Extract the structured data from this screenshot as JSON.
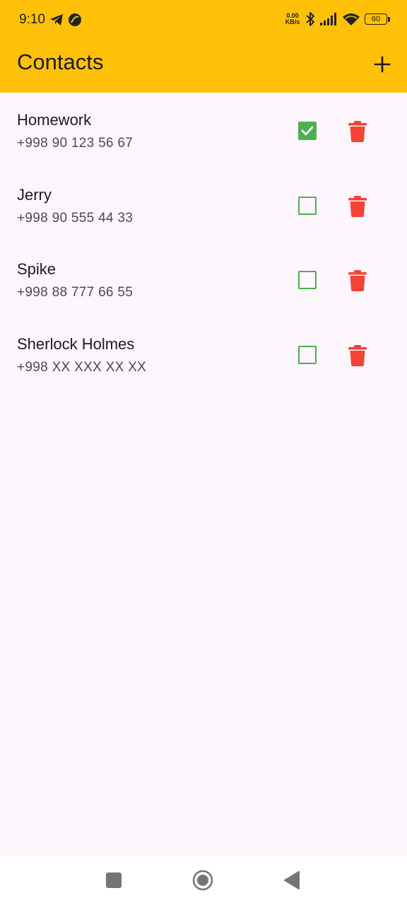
{
  "status_bar": {
    "time": "9:10",
    "net_speed_value": "0.00",
    "net_speed_unit": "KB/s",
    "battery": "60",
    "icons": [
      "telegram-icon",
      "moon-icon",
      "bluetooth-icon",
      "signal-icon",
      "wifi-icon",
      "battery-icon"
    ]
  },
  "app_bar": {
    "title": "Contacts",
    "add_icon": "plus-icon",
    "background": "#ffc107"
  },
  "contacts": [
    {
      "name": "Homework",
      "phone": "+998 90 123 56 67",
      "checked": true
    },
    {
      "name": "Jerry",
      "phone": "+998 90 555 44 33",
      "checked": false
    },
    {
      "name": "Spike",
      "phone": "+998 88 777 66 55",
      "checked": false
    },
    {
      "name": "Sherlock Holmes",
      "phone": "+998 XX XXX XX XX",
      "checked": false
    }
  ],
  "colors": {
    "accent": "#ffc107",
    "checkbox": "#4caf50",
    "delete": "#f44336",
    "background": "#fdf7fd"
  },
  "nav_bar": {
    "icons": [
      "recents-icon",
      "home-icon",
      "back-icon"
    ]
  }
}
